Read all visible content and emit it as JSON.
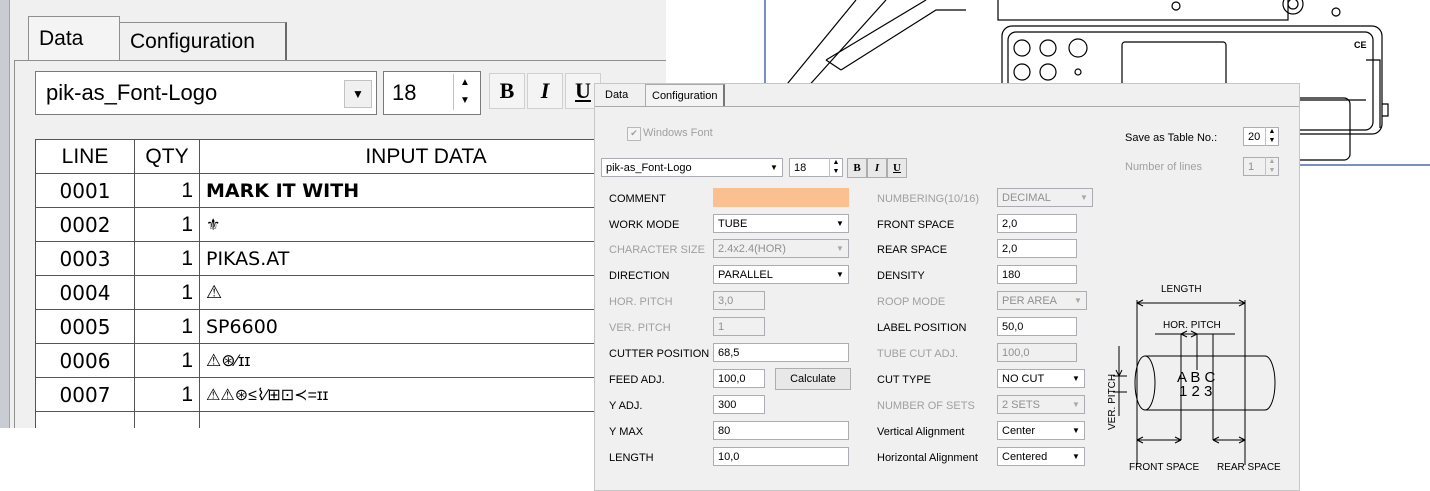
{
  "back_window": {
    "tabs": [
      "Data",
      "Configuration"
    ],
    "font_name": "pik-as_Font-Logo",
    "font_size": "18",
    "format_buttons": [
      "B",
      "I",
      "U"
    ],
    "table": {
      "headers": [
        "LINE",
        "QTY",
        "INPUT DATA"
      ],
      "rows": [
        {
          "line": "0001",
          "qty": "1",
          "data": "MARK IT WITH"
        },
        {
          "line": "0002",
          "qty": "1",
          "data": "⚜"
        },
        {
          "line": "0003",
          "qty": "1",
          "data": "PIKAS.AT"
        },
        {
          "line": "0004",
          "qty": "1",
          "data": "⚠"
        },
        {
          "line": "0005",
          "qty": "1",
          "data": "SP6600"
        },
        {
          "line": "0006",
          "qty": "1",
          "data": "⚠⊛⁄ɪɪ"
        },
        {
          "line": "0007",
          "qty": "1",
          "data": "⚠⚠⊛≤⌇⁄⊞⊡≺=ɪɪ"
        }
      ]
    }
  },
  "front_window": {
    "tabs": [
      "Data",
      "Configuration"
    ],
    "windows_font_label": "Windows Font",
    "save_as_table_label": "Save as Table No.:",
    "save_as_table_value": "20",
    "number_of_lines_label": "Number of lines",
    "number_of_lines_value": "1",
    "font_name": "pik-as_Font-Logo",
    "font_size": "18",
    "format_buttons": [
      "B",
      "I",
      "U"
    ],
    "left_fields": [
      {
        "label": "COMMENT",
        "value": "",
        "type": "input",
        "disabled": false
      },
      {
        "label": "WORK MODE",
        "value": "TUBE",
        "type": "select",
        "disabled": false
      },
      {
        "label": "CHARACTER SIZE",
        "value": "2.4x2.4(HOR)",
        "type": "select",
        "disabled": true
      },
      {
        "label": "DIRECTION",
        "value": "PARALLEL",
        "type": "select",
        "disabled": false
      },
      {
        "label": "HOR. PITCH",
        "value": "3,0",
        "type": "input",
        "disabled": true
      },
      {
        "label": "VER. PITCH",
        "value": "1",
        "type": "input",
        "disabled": true
      },
      {
        "label": "CUTTER POSITION",
        "value": "68,5",
        "type": "input",
        "disabled": false
      },
      {
        "label": "FEED ADJ.",
        "value": "100,0",
        "type": "input",
        "disabled": false
      },
      {
        "label": "Y ADJ.",
        "value": "300",
        "type": "input",
        "disabled": false
      },
      {
        "label": "Y MAX",
        "value": "80",
        "type": "input",
        "disabled": false
      },
      {
        "label": "LENGTH",
        "value": "10,0",
        "type": "input",
        "disabled": false
      }
    ],
    "calculate_label": "Calculate",
    "right_fields": [
      {
        "label": "NUMBERING(10/16)",
        "value": "DECIMAL",
        "type": "select",
        "disabled": true
      },
      {
        "label": "FRONT SPACE",
        "value": "2,0",
        "type": "input",
        "disabled": false
      },
      {
        "label": "REAR SPACE",
        "value": "2,0",
        "type": "input",
        "disabled": false
      },
      {
        "label": "DENSITY",
        "value": "180",
        "type": "input",
        "disabled": false
      },
      {
        "label": "ROOP MODE",
        "value": "PER AREA",
        "type": "select",
        "disabled": true
      },
      {
        "label": "LABEL POSITION",
        "value": "50,0",
        "type": "input",
        "disabled": false
      },
      {
        "label": "TUBE CUT ADJ.",
        "value": "100,0",
        "type": "input",
        "disabled": true
      },
      {
        "label": "CUT TYPE",
        "value": "NO CUT",
        "type": "select",
        "disabled": false
      },
      {
        "label": "NUMBER OF SETS",
        "value": "2 SETS",
        "type": "select",
        "disabled": true
      },
      {
        "label": "Vertical Alignment",
        "value": "Center",
        "type": "select",
        "disabled": false
      },
      {
        "label": "Horizontal Alignment",
        "value": "Centered",
        "type": "select",
        "disabled": false
      }
    ],
    "diagram": {
      "length": "LENGTH",
      "hor_pitch": "HOR. PITCH",
      "ver_pitch": "VER. PITCH",
      "chars_top": "A B C",
      "chars_bottom": "1 2 3",
      "front_space": "FRONT SPACE",
      "rear_space": "REAR SPACE"
    }
  },
  "device_image": {
    "mark": "CE"
  },
  "colors": {
    "comment_field": "#fac090",
    "window_bg": "#f0f0f0",
    "frame_blue": "#7a8fc0"
  }
}
